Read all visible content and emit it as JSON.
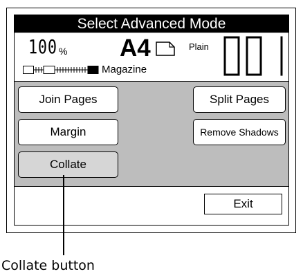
{
  "window": {
    "title": "Select Advanced Mode"
  },
  "status": {
    "zoom_digits": "100",
    "zoom_unit": "%",
    "paper_size": "A4",
    "paper_type": "Plain",
    "document_type": "Magazine",
    "copies_digits": "001",
    "density_level": 6,
    "density_steps": 9
  },
  "buttons": {
    "join_pages": "Join Pages",
    "margin": "Margin",
    "collate": "Collate",
    "split_pages": "Split Pages",
    "remove_shadows": "Remove Shadows",
    "exit": "Exit"
  },
  "callout": {
    "label": "Collate button"
  },
  "colors": {
    "title_bar": "#000000",
    "panel_background": "#bdbdbd",
    "button_active": "#d6d6d6"
  }
}
